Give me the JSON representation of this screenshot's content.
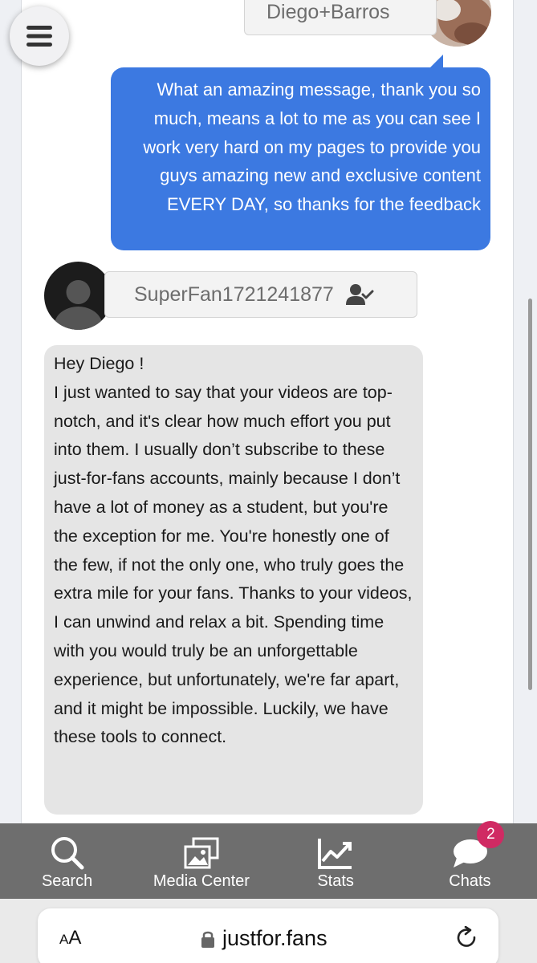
{
  "thread": {
    "sender_name": "Diego+Barros",
    "outgoing_message": "What an amazing message, thank you so much, means a lot to me as you can see I work very hard on my pages to provide you guys amazing new and exclusive content EVERY DAY, so thanks for the feedback",
    "fan_name": "SuperFan1721241877",
    "incoming_greeting": "Hey Diego !",
    "incoming_message": "I just wanted to say that your videos are top-notch, and it's clear how much effort you put into them. I usually don’t subscribe to these just-for-fans accounts, mainly because I don’t have a lot of money as a student, but you're the exception for me. You're honestly one of the few, if not the only one, who truly goes the extra mile for your fans. Thanks to your videos, I can unwind and relax a bit. Spending time with you would truly be an unforgettable experience, but unfortunately, we're far apart, and it might be impossible. Luckily, we have these tools to connect."
  },
  "nav": {
    "search": "Search",
    "media_center": "Media Center",
    "stats": "Stats",
    "chats": "Chats",
    "chats_badge": "2"
  },
  "browser": {
    "text_size_small": "A",
    "text_size_large": "A",
    "url": "justfor.fans"
  },
  "colors": {
    "outgoing_bubble": "#3c79e1",
    "incoming_bubble": "#e5e5e5",
    "nav_bar": "#6e6e6e",
    "badge": "#d02a63"
  },
  "icons": [
    "menu-icon",
    "verified-user-icon",
    "search-icon",
    "media-icon",
    "stats-icon",
    "chat-icon",
    "lock-icon",
    "reload-icon"
  ]
}
